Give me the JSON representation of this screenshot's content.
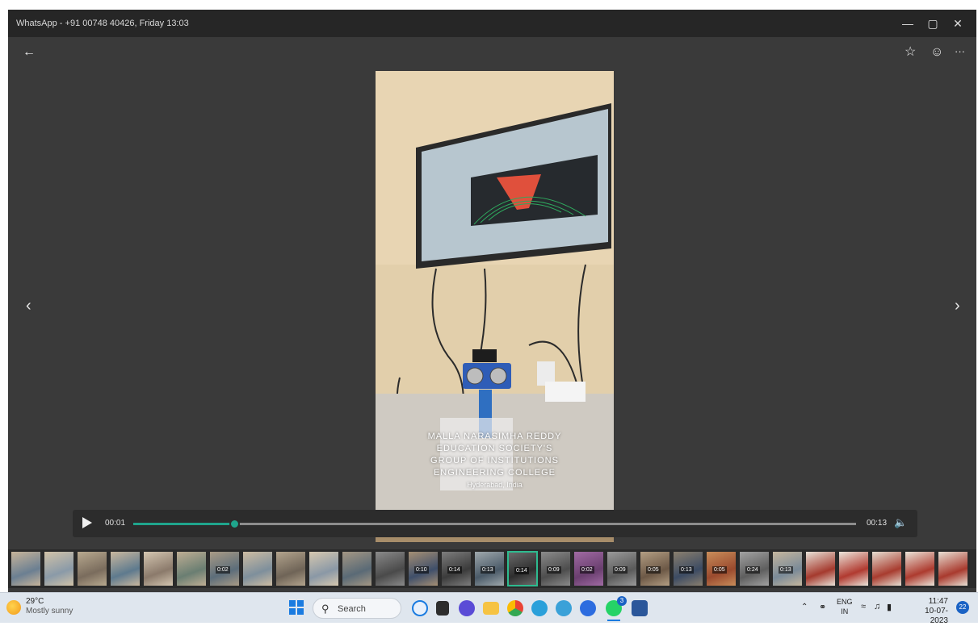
{
  "window": {
    "title": "WhatsApp - +91 00748 40426, Friday 13:03",
    "minimize": "—",
    "restore": "▢",
    "close": "✕"
  },
  "toolbar": {
    "back_icon": "←",
    "star_icon": "☆",
    "emoji_icon": "☺",
    "more_icon": "···"
  },
  "viewer": {
    "prev_icon": "‹",
    "next_icon": "›",
    "watermark": [
      "MALLA NARASIMHA REDDY",
      "EDUCATION SOCIETY'S",
      "GROUP OF INSTITUTIONS",
      "ENGINEERING COLLEGE"
    ],
    "watermark_small": "Hyderabad, India"
  },
  "player": {
    "current_time": "00:01",
    "duration": "00:13",
    "progress": 0.14,
    "accent": "#1fa58c",
    "volume_icon": "🔈"
  },
  "filmstrip": {
    "labels": [
      "",
      "",
      "",
      "",
      "",
      "",
      "0:02",
      "",
      "",
      "",
      "",
      "",
      "0:10",
      "0:14",
      "0:13",
      "0:14",
      "0:09",
      "0:02",
      "0:09",
      "0:05",
      "0:13",
      "0:05",
      "0:24",
      "0:13",
      "",
      "",
      "",
      "",
      ""
    ],
    "selected_index": 15
  },
  "taskbar": {
    "weather_temp": "29°C",
    "weather_desc": "Mostly sunny",
    "search_label": "Search",
    "lang_top": "ENG",
    "lang_bottom": "IN",
    "time": "11:47",
    "date": "10-07-2023",
    "notif_count": "22",
    "whatsapp_badge": "3"
  }
}
